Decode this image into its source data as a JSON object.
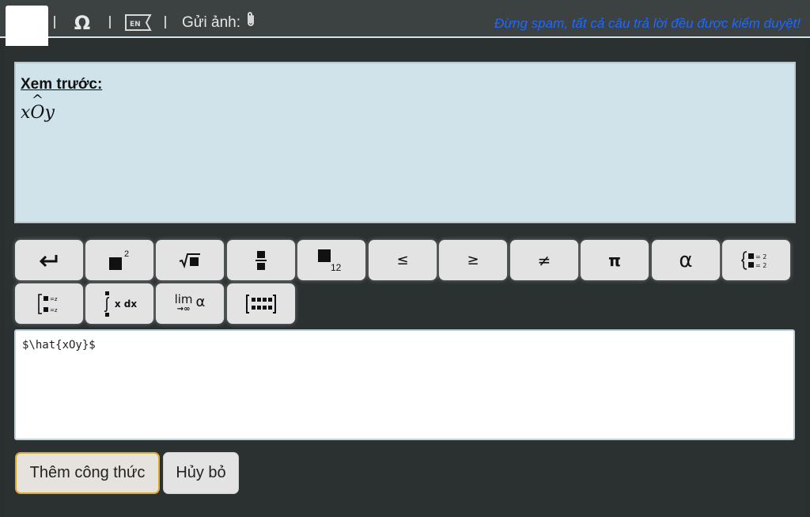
{
  "toolbar": {
    "special_chars_icon": "omega-icon",
    "language_badge": "EN",
    "upload_label": "Gửi ảnh:",
    "upload_icon": "paperclip-icon",
    "warning_text": "Đừng spam, tất cả câu trả lời đều được kiểm duyệt!",
    "warning_color": "#1f68ff"
  },
  "preview": {
    "title": "Xem trước:",
    "math_x": "x",
    "math_hat": "O",
    "math_y": "y"
  },
  "keyboard": {
    "leq": "≤",
    "geq": "≥",
    "neq": "≠",
    "pi": "π",
    "alpha": "α",
    "power_exp": "2",
    "subscript": "12",
    "limit_label": "lim",
    "limit_sub": "→∞",
    "integral_label": "x dx"
  },
  "editor": {
    "value": "$\\hat{xOy}$"
  },
  "actions": {
    "insert_label": "Thêm công thức",
    "cancel_label": "Hủy bỏ"
  },
  "colors": {
    "preview_bg": "#d0e3ea",
    "primary_border": "#d8a833"
  }
}
